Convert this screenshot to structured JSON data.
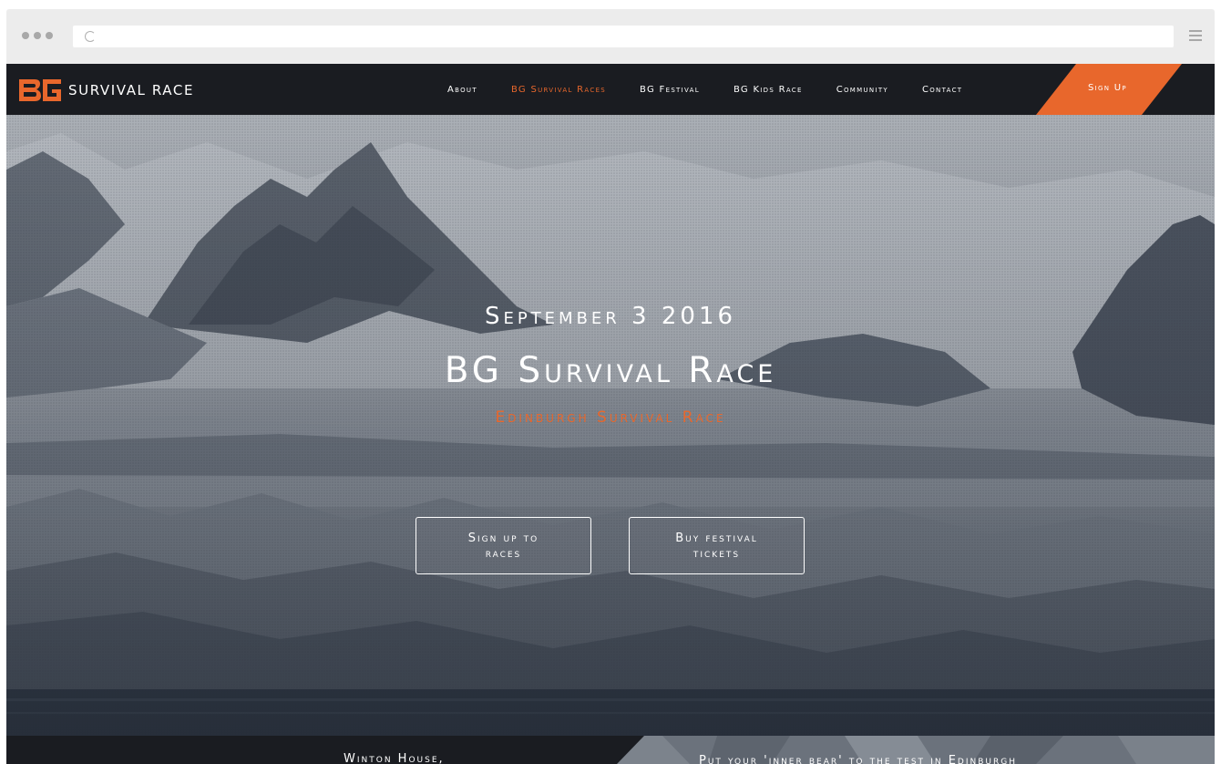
{
  "browser": {
    "icons": [
      "reload-icon",
      "hamburger-menu-icon"
    ]
  },
  "brand": {
    "logo_mark": "BG",
    "logo_text": "SURVIVAL RACE",
    "accent_color": "#e8672c",
    "nav_bg_color": "#1a1c21"
  },
  "nav": {
    "items": [
      {
        "label": "About"
      },
      {
        "label": "BG Survival Races"
      },
      {
        "label": "BG Festival"
      },
      {
        "label": "BG Kids Race"
      },
      {
        "label": "Community"
      },
      {
        "label": "Contact"
      }
    ],
    "active": "BG Survival Races",
    "signup_label": "Sign Up"
  },
  "hero": {
    "date": "September 3 2016",
    "title": "BG Survival Race",
    "subtitle": "Edinburgh Survival Race",
    "buttons": {
      "races": [
        "Sign up to",
        "races"
      ],
      "festival": [
        "Buy festival",
        "tickets"
      ]
    }
  },
  "bottom": {
    "left_text": "Winton House,",
    "right_text": "Put your 'inner bear' to the test in Edinburgh"
  }
}
